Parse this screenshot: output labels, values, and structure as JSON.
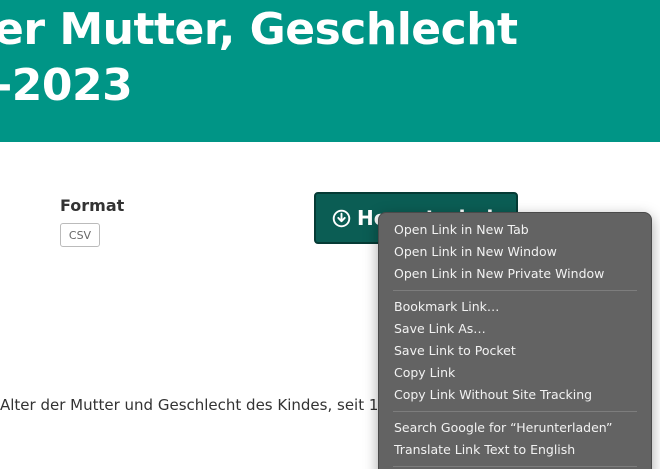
{
  "hero": {
    "title_line1": "er Mutter, Geschlecht",
    "title_line2": "-2023"
  },
  "format": {
    "label": "Format",
    "badge": "CSV"
  },
  "download_button": {
    "label": "Herunterladen",
    "icon": "download-circle-icon"
  },
  "description": "Alter der Mutter und Geschlecht des Kindes, seit 19",
  "context_menu": {
    "groups": [
      [
        "Open Link in New Tab",
        "Open Link in New Window",
        "Open Link in New Private Window"
      ],
      [
        "Bookmark Link…",
        "Save Link As…",
        "Save Link to Pocket",
        "Copy Link",
        "Copy Link Without Site Tracking"
      ],
      [
        "Search Google for “Herunterladen”",
        "Translate Link Text to English"
      ]
    ]
  },
  "colors": {
    "hero_background": "#009586",
    "button_background": "#0b5d54",
    "menu_background": "#636363"
  }
}
